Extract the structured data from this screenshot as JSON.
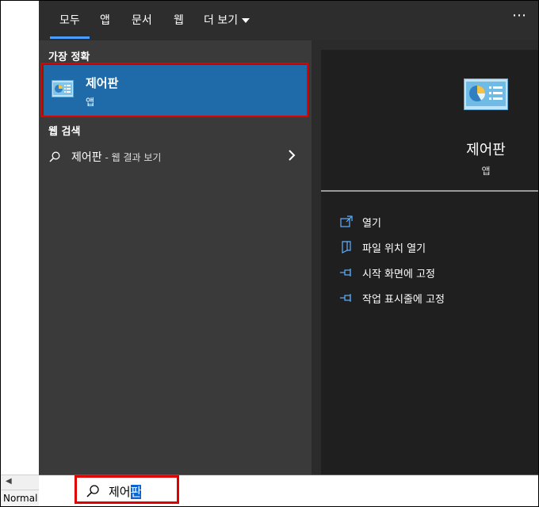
{
  "tabs": [
    {
      "label": "모두"
    },
    {
      "label": "앱"
    },
    {
      "label": "문서"
    },
    {
      "label": "웹"
    },
    {
      "label": "더 보기"
    }
  ],
  "best_match": {
    "section_label": "가장 정확",
    "title": "제어판",
    "subtitle": "앱"
  },
  "web_search": {
    "section_label": "웹 검색",
    "query": "제어판",
    "suffix": " - 웹 결과 보기"
  },
  "detail": {
    "title": "제어판",
    "subtitle": "앱",
    "actions": [
      {
        "label": "열기",
        "icon": "open-icon"
      },
      {
        "label": "파일 위치 열기",
        "icon": "file-location-icon"
      },
      {
        "label": "시작 화면에 고정",
        "icon": "pin-icon"
      },
      {
        "label": "작업 표시줄에 고정",
        "icon": "pin-icon"
      }
    ]
  },
  "taskbar": {
    "search_typed": "제어",
    "search_selected": "판"
  },
  "background_app": {
    "status_text": "Normal"
  },
  "colors": {
    "accent": "#1f6aa8",
    "highlight_border": "#e00000",
    "tab_underline": "#4a9eff"
  }
}
